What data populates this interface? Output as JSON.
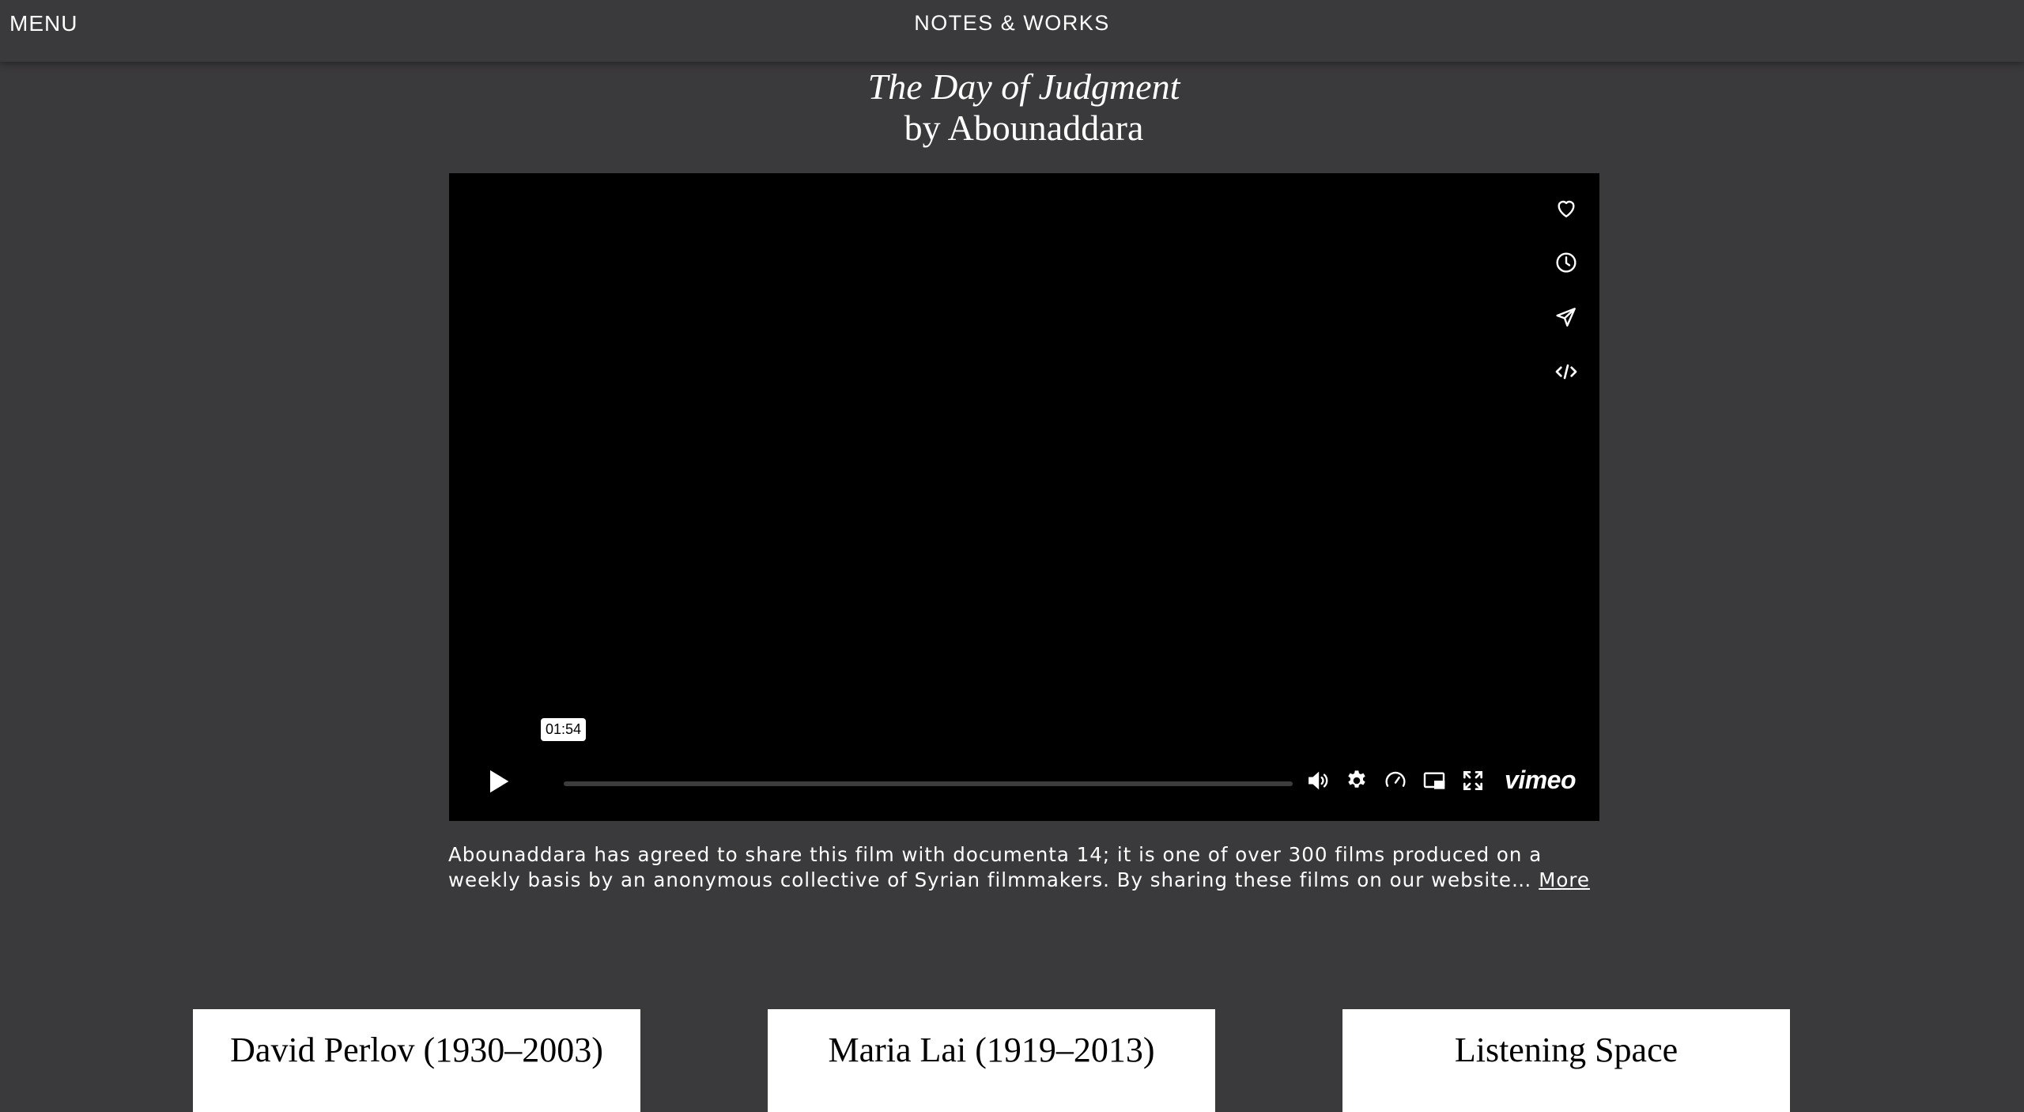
{
  "header": {
    "menu_label": "MENU",
    "site_title": "NOTES & WORKS"
  },
  "page": {
    "title_italic": "The Day of Judgment",
    "title_byline": "by Abounaddara"
  },
  "player": {
    "side_icons": [
      "heart-icon",
      "clock-icon",
      "send-icon",
      "embed-icon"
    ],
    "time_tooltip": "01:54",
    "progress": 0,
    "control_icons": [
      "volume-icon",
      "settings-icon",
      "speed-icon",
      "pip-icon",
      "fullscreen-icon"
    ],
    "brand": "vimeo"
  },
  "description": {
    "text": "Abounaddara has agreed to share this film with documenta 14; it is one of over 300 films produced on a weekly basis by an anonymous collective of Syrian filmmakers. By sharing these films on our website…",
    "more_label": "More"
  },
  "cards": [
    {
      "title": "David Perlov (1930–2003)"
    },
    {
      "title": "Maria Lai (1919–2013)"
    },
    {
      "title": "Listening Space"
    }
  ],
  "colors": {
    "background": "#3a393b",
    "player": "#000000",
    "card": "#ffffff"
  }
}
